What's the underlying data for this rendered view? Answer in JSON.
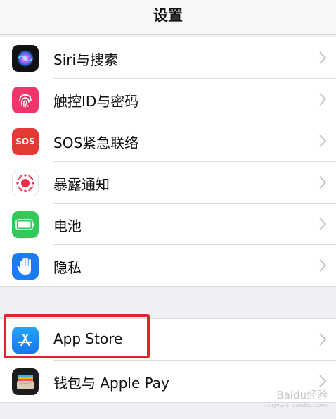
{
  "header": {
    "title": "设置"
  },
  "group1": [
    {
      "label": "Siri与搜索",
      "icon": "siri-icon"
    },
    {
      "label": "触控ID与密码",
      "icon": "fingerprint-icon"
    },
    {
      "label": "SOS紧急联络",
      "icon": "sos-icon",
      "icon_text": "SOS"
    },
    {
      "label": "暴露通知",
      "icon": "exposure-notification-icon"
    },
    {
      "label": "电池",
      "icon": "battery-icon"
    },
    {
      "label": "隐私",
      "icon": "privacy-hand-icon"
    }
  ],
  "group2": [
    {
      "label": "App Store",
      "icon": "app-store-icon"
    },
    {
      "label": "钱包与 Apple Pay",
      "icon": "wallet-icon"
    }
  ],
  "watermark": {
    "text": "Baidu经验",
    "subtext": "jingyan.baidu.com"
  },
  "colors": {
    "highlight": "#e8202a",
    "sos": "#e53935",
    "battery": "#34c759",
    "privacy": "#1a7cf0",
    "app_store": "#1a8cf5",
    "touch_id": "#f0356a"
  }
}
